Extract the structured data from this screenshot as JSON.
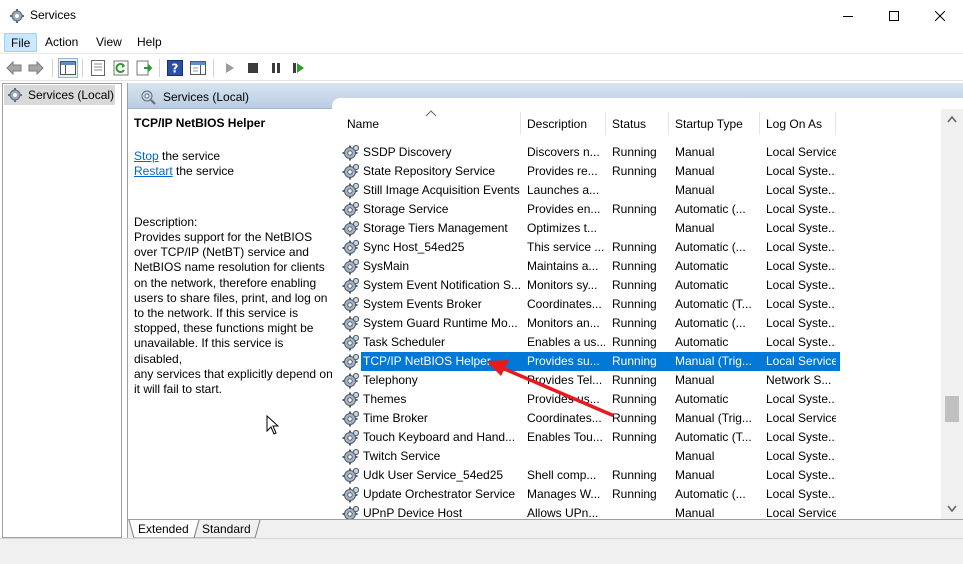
{
  "window": {
    "title": "Services",
    "minimize_icon": "minimize-icon",
    "maximize_icon": "maximize-icon",
    "close_icon": "close-icon"
  },
  "menu": {
    "file": "File",
    "action": "Action",
    "view": "View",
    "help": "Help"
  },
  "toolbar": {
    "icons": [
      "back-arrow-icon",
      "forward-arrow-icon",
      "show-hide-console-tree-icon",
      "properties-icon",
      "refresh-icon",
      "export-list-icon",
      "help-icon",
      "show-hide-action-pane-icon",
      "start-service-icon",
      "stop-service-icon",
      "pause-service-icon",
      "resume-service-icon"
    ]
  },
  "tree": {
    "root_label": "Services (Local)"
  },
  "pane": {
    "header_title": "Services (Local)"
  },
  "details": {
    "service_name": "TCP/IP NetBIOS Helper",
    "stop_link": "Stop",
    "stop_suffix": " the service",
    "restart_link": "Restart",
    "restart_suffix": " the service",
    "description_label": "Description:",
    "description_lines": [
      "Provides support for the NetBIOS",
      "over TCP/IP (NetBT) service and",
      "NetBIOS name resolution for clients",
      "on the network, therefore enabling",
      "users to share files, print, and log on",
      "to the network. If this service is",
      "stopped, these functions might be",
      "unavailable. If this service is disabled,",
      "any services that explicitly depend on",
      "it will fail to start."
    ]
  },
  "columns": {
    "name": "Name",
    "description": "Description",
    "status": "Status",
    "startup_type": "Startup Type",
    "log_on_as": "Log On As"
  },
  "services": [
    {
      "name": "SSDP Discovery",
      "description": "Discovers n...",
      "status": "Running",
      "startup": "Manual",
      "logon": "Local Service"
    },
    {
      "name": "State Repository Service",
      "description": "Provides re...",
      "status": "Running",
      "startup": "Manual",
      "logon": "Local Syste..."
    },
    {
      "name": "Still Image Acquisition Events",
      "description": "Launches a...",
      "status": "",
      "startup": "Manual",
      "logon": "Local Syste..."
    },
    {
      "name": "Storage Service",
      "description": "Provides en...",
      "status": "Running",
      "startup": "Automatic (...",
      "logon": "Local Syste..."
    },
    {
      "name": "Storage Tiers Management",
      "description": "Optimizes t...",
      "status": "",
      "startup": "Manual",
      "logon": "Local Syste..."
    },
    {
      "name": "Sync Host_54ed25",
      "description": "This service ...",
      "status": "Running",
      "startup": "Automatic (...",
      "logon": "Local Syste..."
    },
    {
      "name": "SysMain",
      "description": "Maintains a...",
      "status": "Running",
      "startup": "Automatic",
      "logon": "Local Syste..."
    },
    {
      "name": "System Event Notification S...",
      "description": "Monitors sy...",
      "status": "Running",
      "startup": "Automatic",
      "logon": "Local Syste..."
    },
    {
      "name": "System Events Broker",
      "description": "Coordinates...",
      "status": "Running",
      "startup": "Automatic (T...",
      "logon": "Local Syste..."
    },
    {
      "name": "System Guard Runtime Mo...",
      "description": "Monitors an...",
      "status": "Running",
      "startup": "Automatic (...",
      "logon": "Local Syste..."
    },
    {
      "name": "Task Scheduler",
      "description": "Enables a us...",
      "status": "Running",
      "startup": "Automatic",
      "logon": "Local Syste..."
    },
    {
      "name": "TCP/IP NetBIOS Helper",
      "description": "Provides su...",
      "status": "Running",
      "startup": "Manual (Trig...",
      "logon": "Local Service"
    },
    {
      "name": "Telephony",
      "description": "Provides Tel...",
      "status": "Running",
      "startup": "Manual",
      "logon": "Network S..."
    },
    {
      "name": "Themes",
      "description": "Provides us...",
      "status": "Running",
      "startup": "Automatic",
      "logon": "Local Syste..."
    },
    {
      "name": "Time Broker",
      "description": "Coordinates...",
      "status": "Running",
      "startup": "Manual (Trig...",
      "logon": "Local Service"
    },
    {
      "name": "Touch Keyboard and Hand...",
      "description": "Enables Tou...",
      "status": "Running",
      "startup": "Automatic (T...",
      "logon": "Local Syste..."
    },
    {
      "name": "Twitch Service",
      "description": "",
      "status": "",
      "startup": "Manual",
      "logon": "Local Syste..."
    },
    {
      "name": "Udk User Service_54ed25",
      "description": "Shell comp...",
      "status": "Running",
      "startup": "Manual",
      "logon": "Local Syste..."
    },
    {
      "name": "Update Orchestrator Service",
      "description": "Manages W...",
      "status": "Running",
      "startup": "Automatic (...",
      "logon": "Local Syste..."
    },
    {
      "name": "UPnP Device Host",
      "description": "Allows UPn...",
      "status": "",
      "startup": "Manual",
      "logon": "Local Service"
    }
  ],
  "tabs": {
    "extended": "Extended",
    "standard": "Standard"
  },
  "colors": {
    "selection": "#0078d7",
    "annotation_arrow": "#e8191f",
    "link": "#0066cc"
  }
}
